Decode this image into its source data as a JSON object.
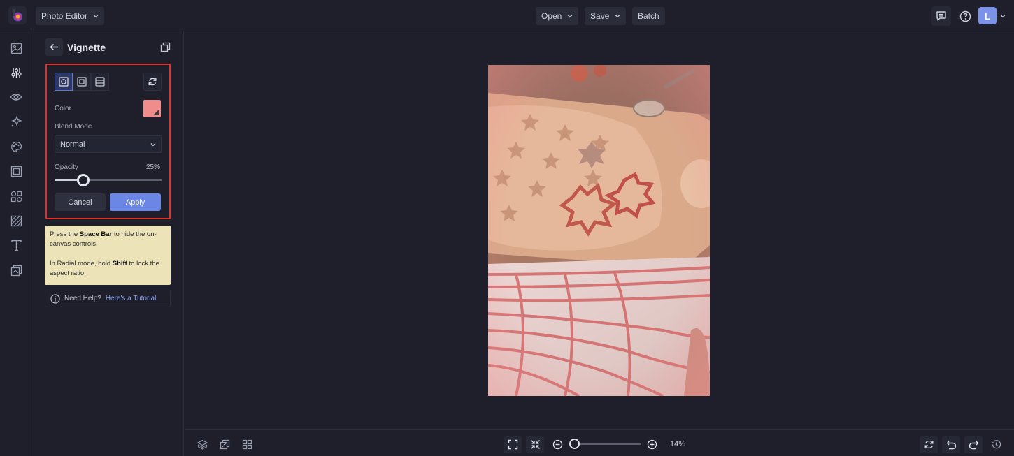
{
  "topbar": {
    "app_menu_label": "Photo Editor",
    "open_label": "Open",
    "save_label": "Save",
    "batch_label": "Batch",
    "avatar_initial": "L"
  },
  "rail": {
    "tools": [
      "layout-icon",
      "adjust-icon",
      "eye-icon",
      "magic-icon",
      "art-icon",
      "frame-icon",
      "graphics-icon",
      "texture-icon",
      "text-icon",
      "overlay-icon"
    ]
  },
  "panel": {
    "title": "Vignette",
    "color_label": "Color",
    "color_value": "#f08c8c",
    "blend_mode_label": "Blend Mode",
    "blend_mode_value": "Normal",
    "opacity_label": "Opacity",
    "opacity_value": "25%",
    "opacity_fraction": 0.27,
    "cancel_label": "Cancel",
    "apply_label": "Apply",
    "tip1_pre": "Press the ",
    "tip1_key": "Space Bar",
    "tip1_post": " to hide the on-canvas controls.",
    "tip2_pre": "In Radial mode, hold ",
    "tip2_key": "Shift",
    "tip2_post": " to lock the aspect ratio.",
    "help_text": "Need Help?",
    "help_link": "Here's a Tutorial"
  },
  "bottombar": {
    "zoom_label": "14%",
    "zoom_fraction": 0.0
  },
  "colors": {
    "accent": "#6c86e6",
    "highlight_border": "#e0322b",
    "background": "#1e1f2a"
  }
}
